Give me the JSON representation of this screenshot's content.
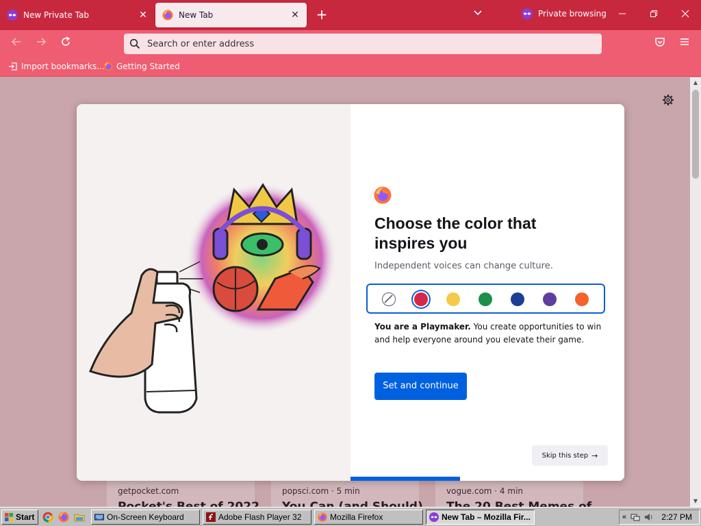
{
  "tabs": [
    {
      "label": "New Private Tab",
      "active": false
    },
    {
      "label": "New Tab",
      "active": true
    }
  ],
  "private_indicator": "Private browsing",
  "urlbar": {
    "placeholder": "Search or enter address"
  },
  "bookmarks": [
    {
      "label": "Import bookmarks..."
    },
    {
      "label": "Getting Started"
    }
  ],
  "modal": {
    "heading": "Choose the color that inspires you",
    "subtitle": "Independent voices can change culture.",
    "colors": [
      "#ffffff",
      "#d7264b",
      "#f5c94a",
      "#1e8f4a",
      "#1b3f93",
      "#5f3e9e",
      "#f2622a"
    ],
    "selected_color_index": 1,
    "description_bold": "You are a Playmaker.",
    "description_rest": " You create opportunities to win and help everyone around you elevate their game.",
    "primary_button": "Set and continue",
    "skip_button": "Skip this step",
    "progress": 0.4
  },
  "stories": [
    {
      "source": "getpocket.com",
      "title": "Pocket's Best of 2022"
    },
    {
      "source": "popsci.com · 5 min",
      "title": "You Can (and Should)"
    },
    {
      "source": "vogue.com · 4 min",
      "title": "The 20 Best Memes of"
    }
  ],
  "taskbar": {
    "start": "Start",
    "buttons": [
      {
        "label": "On-Screen Keyboard",
        "pressed": false
      },
      {
        "label": "Adobe Flash Player 32",
        "pressed": false
      },
      {
        "label": "Mozilla Firefox",
        "pressed": false
      },
      {
        "label": "New Tab – Mozilla Fir...",
        "pressed": true
      }
    ],
    "clock": "2:27 PM"
  },
  "colors": {
    "tabstrip": "#c8283e",
    "toolbar": "#ee5d71",
    "page_bg": "#c9a6ab",
    "primary_blue": "#0061e0"
  }
}
